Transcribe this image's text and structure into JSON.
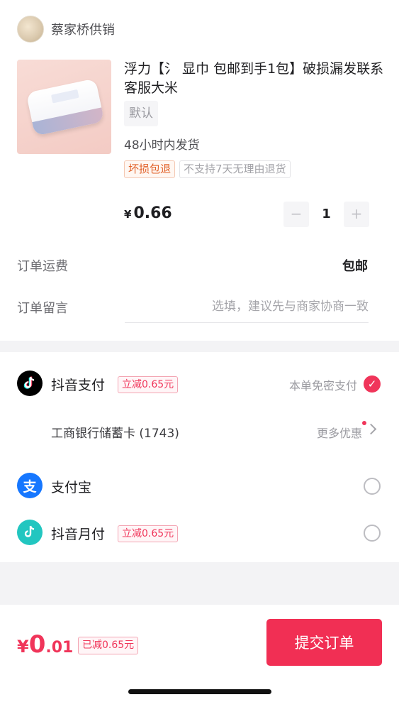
{
  "shop": {
    "name": "蔡家桥供销"
  },
  "product": {
    "title": "浮力【氵 显巾 包邮到手1包】破损漏发联系客服大米",
    "spec": "默认",
    "shipping_time": "48小时内发货",
    "tags": [
      "坏损包退",
      "不支持7天无理由退货"
    ],
    "price_symbol": "¥",
    "price": "0.66",
    "quantity": "1",
    "minus_symbol": "−",
    "plus_symbol": "+"
  },
  "order": {
    "shipping_label": "订单运费",
    "shipping_value": "包邮",
    "note_label": "订单留言",
    "note_placeholder": "选填，建议先与商家协商一致"
  },
  "payment": {
    "douyin_pay": {
      "name": "抖音支付",
      "tag": "立减0.65元",
      "status_text": "本单免密支付",
      "icon": "douyin-logo-icon",
      "icon_color": "#000000"
    },
    "bank_card": {
      "name": "工商银行储蓄卡 (1743)",
      "more_offers": "更多优惠"
    },
    "alipay": {
      "name": "支付宝",
      "icon_glyph": "支",
      "icon": "alipay-logo-icon",
      "icon_color": "#1677ff"
    },
    "douyin_monthly": {
      "name": "抖音月付",
      "tag": "立减0.65元",
      "icon": "douyin-monthly-logo-icon",
      "icon_color": "#22c6c0"
    },
    "check_glyph": "✓"
  },
  "footer": {
    "total_symbol": "¥",
    "total_int": "0",
    "total_dec": ".01",
    "saved_tag": "已减0.65元",
    "submit_label": "提交订单"
  },
  "colors": {
    "accent": "#f0355a",
    "orange_tag": "#e2622a"
  }
}
